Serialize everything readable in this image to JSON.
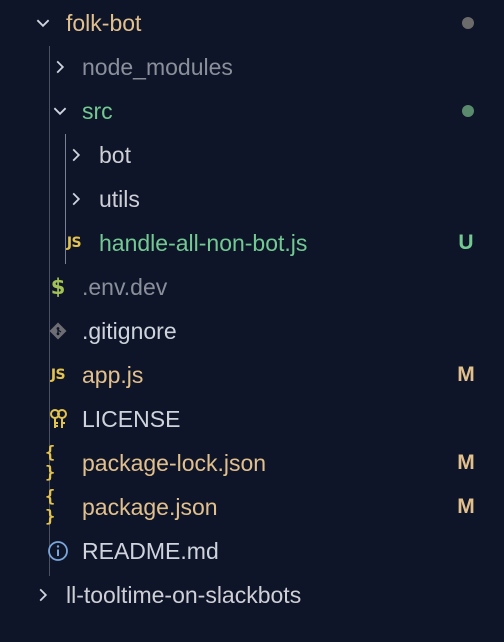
{
  "colors": {
    "background": "#0e1529",
    "text_default": "#cfd4dc",
    "text_muted": "#8a8f99",
    "untracked_green": "#73c991",
    "modified_yellow": "#e2c08d",
    "folder_text": "#cfcfd6",
    "dot_gray": "#6b6b6b",
    "dot_green": "#5a8a6d"
  },
  "tree": {
    "root_folder": {
      "label": "folk-bot",
      "expanded": true,
      "status_dot": "gray"
    },
    "items": [
      {
        "label": "node_modules",
        "type": "folder",
        "expanded": false,
        "icon": "chevron-right-icon"
      },
      {
        "label": "src",
        "type": "folder",
        "expanded": true,
        "icon": "chevron-down-icon",
        "status_dot": "green"
      },
      {
        "label": "bot",
        "type": "folder",
        "expanded": false,
        "icon": "chevron-right-icon"
      },
      {
        "label": "utils",
        "type": "folder",
        "expanded": false,
        "icon": "chevron-right-icon"
      },
      {
        "label": "handle-all-non-bot.js",
        "type": "file",
        "icon_text": "JS",
        "icon": "javascript-icon",
        "badge": "U"
      },
      {
        "label": ".env.dev",
        "type": "file",
        "icon_text": "$",
        "icon": "dollar-env-icon"
      },
      {
        "label": ".gitignore",
        "type": "file",
        "icon": "git-icon"
      },
      {
        "label": "app.js",
        "type": "file",
        "icon_text": "JS",
        "icon": "javascript-icon",
        "badge": "M"
      },
      {
        "label": "LICENSE",
        "type": "file",
        "icon": "key-icon"
      },
      {
        "label": "package-lock.json",
        "type": "file",
        "icon_text": "{ }",
        "icon": "json-braces-icon",
        "badge": "M"
      },
      {
        "label": "package.json",
        "type": "file",
        "icon_text": "{ }",
        "icon": "json-braces-icon",
        "badge": "M"
      },
      {
        "label": "README.md",
        "type": "file",
        "icon": "info-icon"
      }
    ],
    "sibling_folder": {
      "label": "ll-tooltime-on-slackbots",
      "expanded": false
    }
  }
}
